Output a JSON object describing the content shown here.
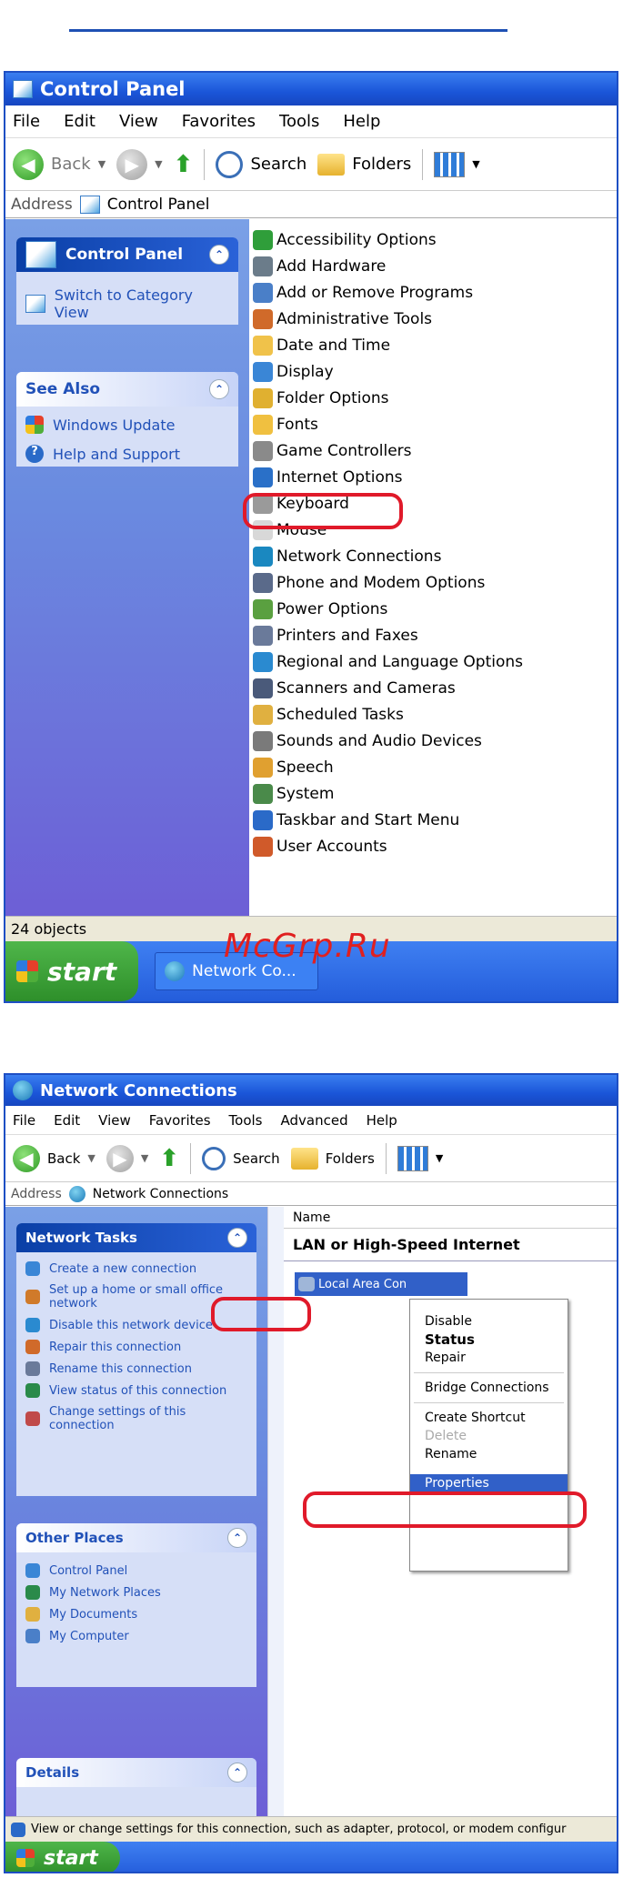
{
  "window1": {
    "title": "Control Panel",
    "menu": [
      "File",
      "Edit",
      "View",
      "Favorites",
      "Tools",
      "Help"
    ],
    "toolbar": {
      "back": "Back",
      "search": "Search",
      "folders": "Folders"
    },
    "address_label": "Address",
    "address_value": "Control Panel",
    "panels": {
      "cp_title": "Control Panel",
      "switch_view": "Switch to Category View",
      "see_also_title": "See Also",
      "see_also_items": [
        "Windows Update",
        "Help and Support"
      ]
    },
    "items": [
      {
        "label": "Accessibility Options",
        "color": "#2f9e3a"
      },
      {
        "label": "Add Hardware",
        "color": "#6b7c8a"
      },
      {
        "label": "Add or Remove Programs",
        "color": "#4a7fc8"
      },
      {
        "label": "Administrative Tools",
        "color": "#d06a2a"
      },
      {
        "label": "Date and Time",
        "color": "#f0c24a"
      },
      {
        "label": "Display",
        "color": "#3a86d6"
      },
      {
        "label": "Folder Options",
        "color": "#e0b030"
      },
      {
        "label": "Fonts",
        "color": "#f0c040"
      },
      {
        "label": "Game Controllers",
        "color": "#8a8a8a"
      },
      {
        "label": "Internet Options",
        "color": "#2a70c8"
      },
      {
        "label": "Keyboard",
        "color": "#9a9a9a"
      },
      {
        "label": "Mouse",
        "color": "#d8d8d8"
      },
      {
        "label": "Network Connections",
        "color": "#1a88c0"
      },
      {
        "label": "Phone and Modem Options",
        "color": "#5a6a8a"
      },
      {
        "label": "Power Options",
        "color": "#5aa040"
      },
      {
        "label": "Printers and Faxes",
        "color": "#6a7a9a"
      },
      {
        "label": "Regional and Language Options",
        "color": "#2a8ad0"
      },
      {
        "label": "Scanners and Cameras",
        "color": "#4a5a7a"
      },
      {
        "label": "Scheduled Tasks",
        "color": "#e0b040"
      },
      {
        "label": "Sounds and Audio Devices",
        "color": "#7a7a7a"
      },
      {
        "label": "Speech",
        "color": "#e0a030"
      },
      {
        "label": "System",
        "color": "#4a8a4a"
      },
      {
        "label": "Taskbar and Start Menu",
        "color": "#2a6ac8"
      },
      {
        "label": "User Accounts",
        "color": "#d05a2a"
      }
    ],
    "status": "24 objects",
    "start": "start",
    "task_item": "Network Co..."
  },
  "watermark": "McGrp.Ru",
  "window2": {
    "title": "Network Connections",
    "menu": [
      "File",
      "Edit",
      "View",
      "Favorites",
      "Tools",
      "Advanced",
      "Help"
    ],
    "toolbar": {
      "back": "Back",
      "search": "Search",
      "folders": "Folders"
    },
    "address_label": "Address",
    "address_value": "Network Connections",
    "network_tasks_title": "Network Tasks",
    "network_tasks": [
      "Create a new connection",
      "Set up a home or small office network",
      "Disable this network device",
      "Repair this connection",
      "Rename this connection",
      "View status of this connection",
      "Change settings of this connection"
    ],
    "other_places_title": "Other Places",
    "other_places": [
      "Control Panel",
      "My Network Places",
      "My Documents",
      "My Computer"
    ],
    "details_title": "Details",
    "column_name": "Name",
    "group_header": "LAN or High-Speed Internet",
    "connection_label": "Local Area Con",
    "context_menu": {
      "disable": "Disable",
      "status": "Status",
      "repair": "Repair",
      "bridge": "Bridge Connections",
      "shortcut": "Create Shortcut",
      "delete": "Delete",
      "rename": "Rename",
      "properties": "Properties"
    },
    "status": "View or change settings for this connection, such as adapter, protocol, or modem configur",
    "start": "start"
  }
}
